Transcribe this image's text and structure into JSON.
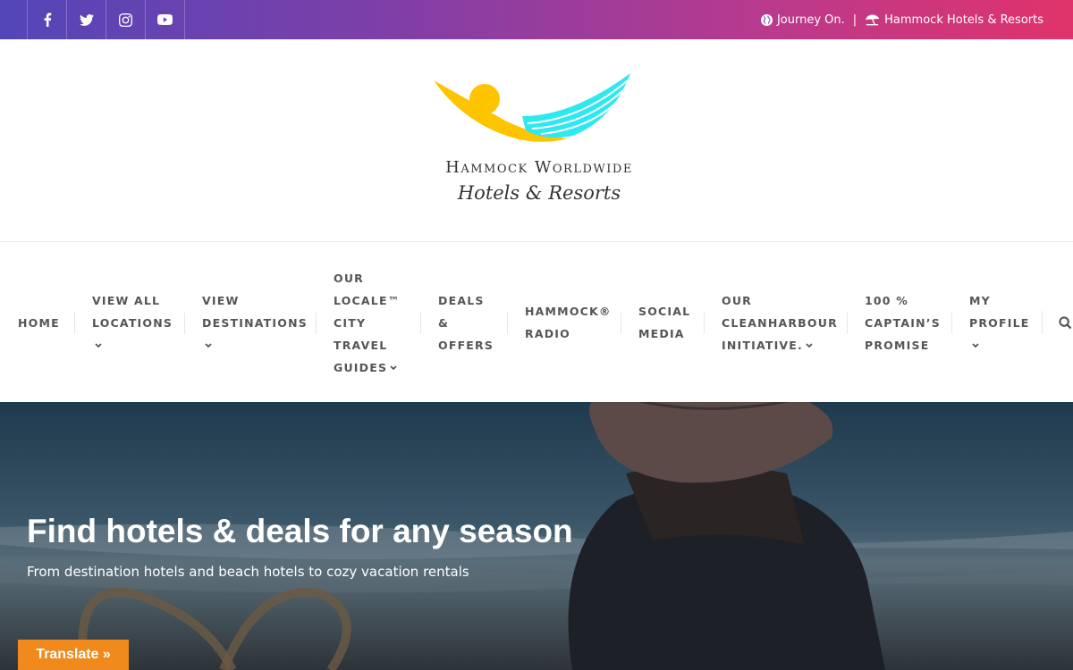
{
  "topbar": {
    "social_icons": [
      "facebook-icon",
      "twitter-icon",
      "instagram-icon",
      "youtube-icon"
    ],
    "links": [
      {
        "icon": "globe-icon",
        "label": "Journey On."
      },
      {
        "icon": "beach-umbrella-icon",
        "label": "Hammock Hotels & Resorts"
      }
    ],
    "separator": "|",
    "colors": {
      "gradient_start": "#5346b8",
      "gradient_end": "#e0336b"
    }
  },
  "logo": {
    "title": "Hammock Worldwide",
    "subtitle": "Hotels & Resorts",
    "colors": {
      "yellow": "#ffc400",
      "cyan": "#2ee8f0"
    }
  },
  "nav": {
    "items": [
      {
        "label": "HOME"
      },
      {
        "label": "VIEW ALL\nLOCATIONS"
      },
      {
        "label": "VIEW\nDESTINATIONS"
      },
      {
        "label": "OUR\nLOCALE™\nCITY\nTRAVEL\nGUIDES"
      },
      {
        "label": "DEALS\n&\nOFFERS"
      },
      {
        "label": "HAMMOCK®\nRADIO"
      },
      {
        "label": "SOCIAL\nMEDIA"
      },
      {
        "label": "OUR\nCLEANHARBOUR\nINITIATIVE."
      },
      {
        "label": "100 %\nCAPTAIN’S\nPROMISE"
      },
      {
        "label": "MY\nPROFILE"
      }
    ],
    "search_icon": "search-icon"
  },
  "hero": {
    "title": "Find hotels & deals for any season",
    "subtitle": "From destination hotels and beach hotels to cozy vacation rentals"
  },
  "translate": {
    "label": "Translate »",
    "color": "#f18a1c"
  }
}
